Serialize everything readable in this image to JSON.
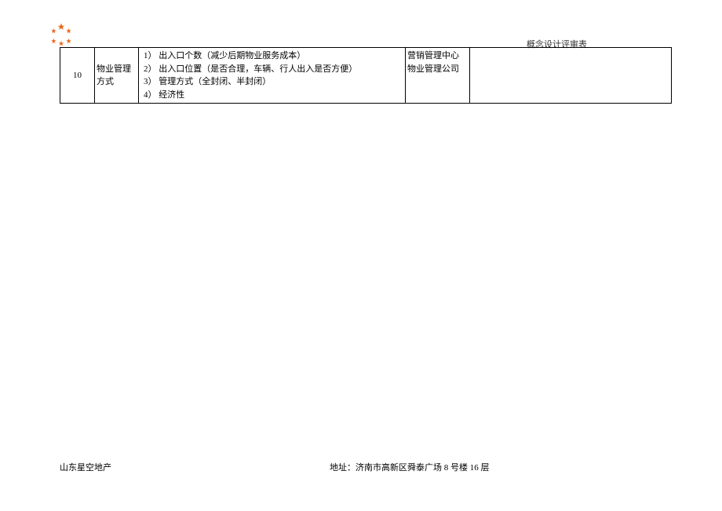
{
  "header": {
    "title": "概念设计评审表"
  },
  "table": {
    "row": {
      "number": "10",
      "topic_line1": "物业管理",
      "topic_line2": "方式",
      "content_line1": "1） 出入口个数（减少后期物业服务成本）",
      "content_line2": "2） 出入口位置（是否合理，车辆、行人出入是否方便）",
      "content_line3": "3） 管理方式（全封闭、半封闭）",
      "content_line4": "4） 经济性",
      "dept_line1": "营销管理中心",
      "dept_line2": "物业管理公司"
    }
  },
  "footer": {
    "company": "山东星空地产",
    "address": "地址：济南市高新区舜泰广场 8 号楼 16 层"
  }
}
